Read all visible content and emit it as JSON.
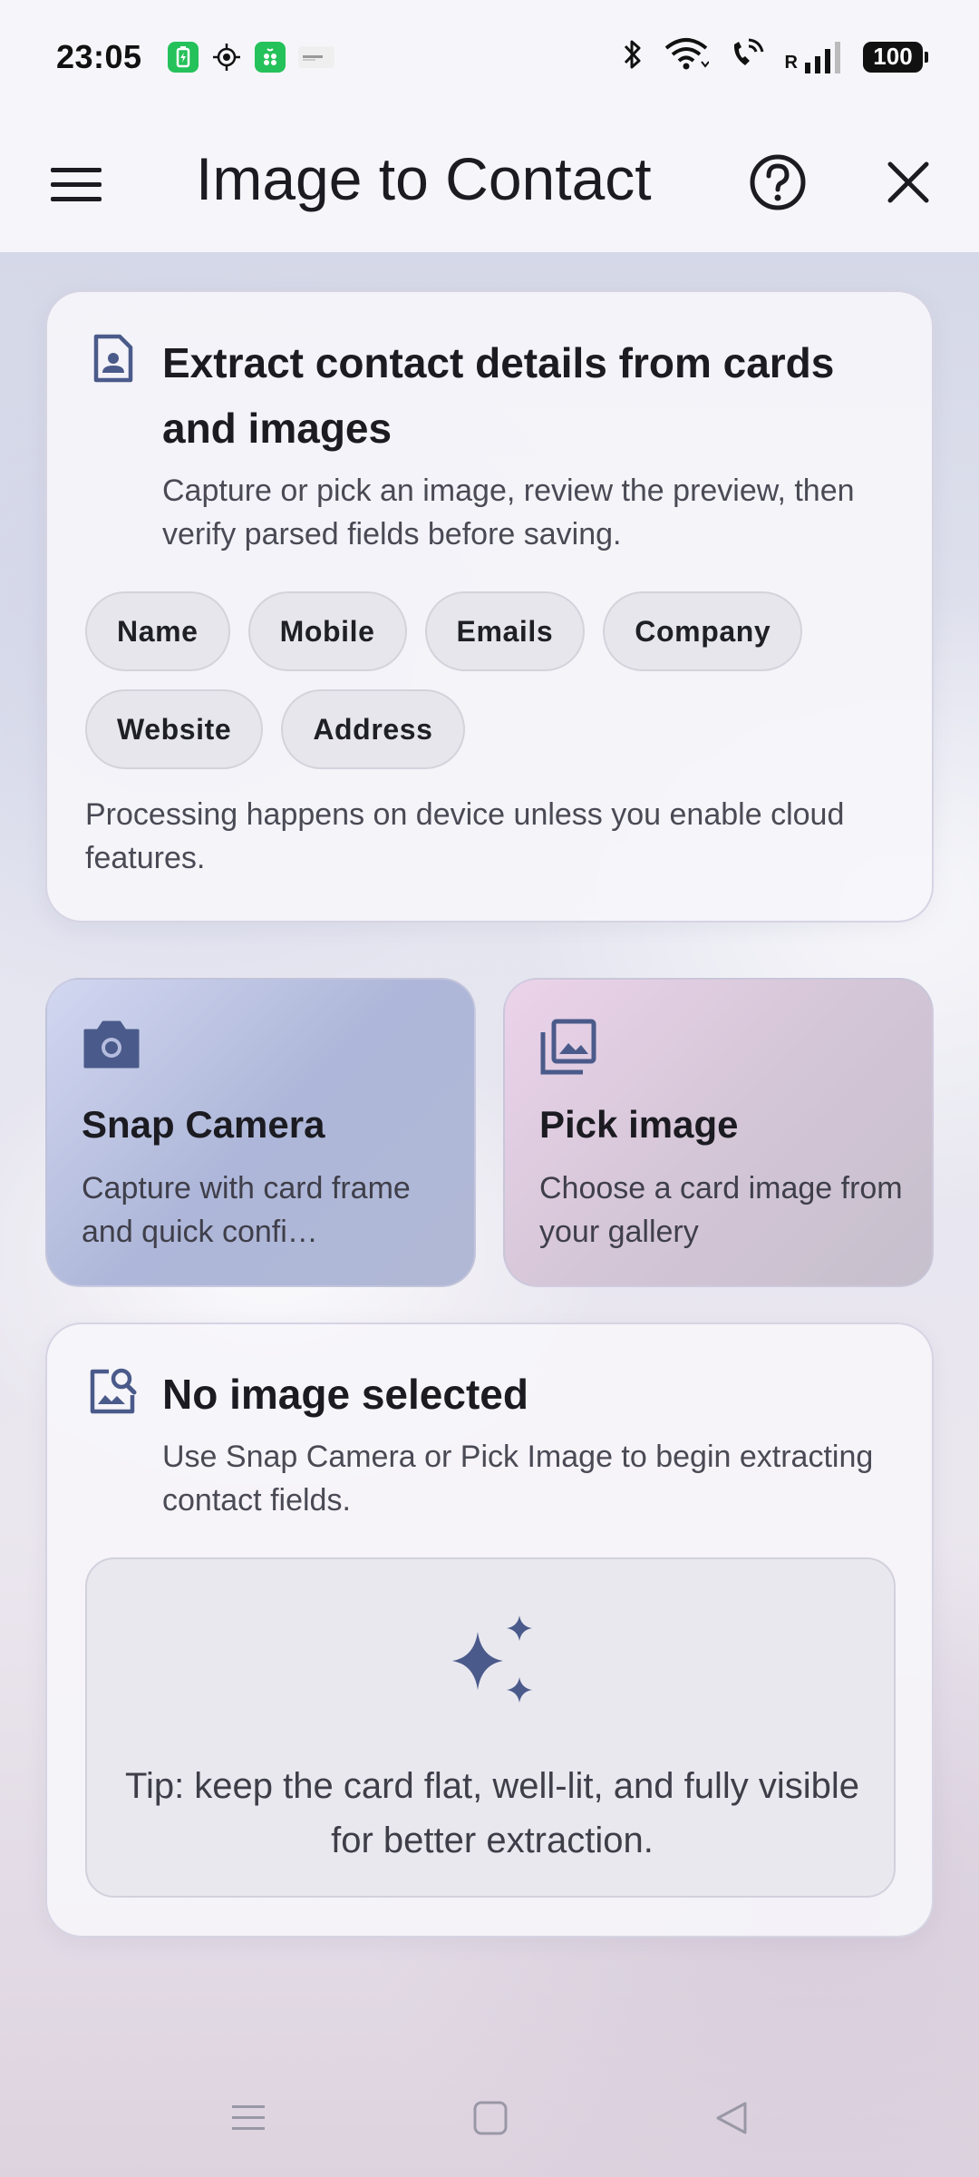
{
  "status_bar": {
    "time": "23:05",
    "battery": "100",
    "signal_label": "R",
    "icons": [
      "battery-saver-icon",
      "location-target-icon",
      "app-grid-icon",
      "notification-thumb-icon",
      "bluetooth-icon",
      "wifi-icon",
      "wifi-call-icon",
      "cell-signal-icon"
    ]
  },
  "app_bar": {
    "title": "Image to Contact",
    "icons": [
      "menu-icon",
      "help-icon",
      "close-icon"
    ]
  },
  "info_card": {
    "title": "Extract contact details from cards and images",
    "subtitle": "Capture or pick an image, review the preview, then verify parsed fields before saving.",
    "chips": [
      "Name",
      "Mobile",
      "Emails",
      "Company",
      "Website",
      "Address"
    ],
    "footer": "Processing happens on device unless you enable cloud features."
  },
  "actions": {
    "snap": {
      "title": "Snap Camera",
      "description": "Capture with card frame and quick confi…"
    },
    "pick": {
      "title": "Pick image",
      "description": "Choose a card image from your gallery"
    }
  },
  "empty_state": {
    "title": "No image selected",
    "subtitle": "Use Snap Camera or Pick Image to begin extracting contact fields.",
    "tip": "Tip: keep the card flat, well-lit, and fully visible for better extraction."
  },
  "colors": {
    "accent": "#4a5a8a",
    "text_primary": "#1b1b21",
    "text_secondary": "#4a4a55",
    "status_green": "#25c15a"
  }
}
